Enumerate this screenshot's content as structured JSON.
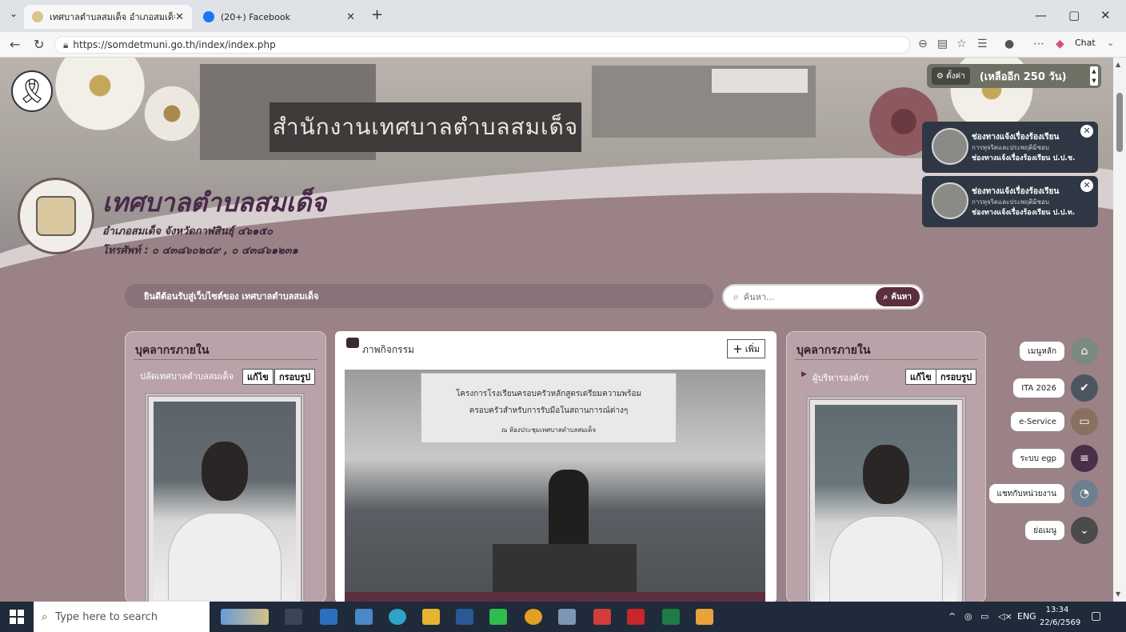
{
  "browser": {
    "tabs": [
      {
        "label": "เทศบาลตำบลสมเด็จ อำเภอสมเด็จ จังหวัด",
        "active": true
      },
      {
        "label": "(20+) Facebook",
        "active": false
      }
    ],
    "new_tab": "+",
    "url": "https://somdetmuni.go.th/index/index.php",
    "chat_label": "Chat"
  },
  "site": {
    "mourning_icon": "ribbon-icon",
    "building_sign": "สำนักงานเทศบาลตำบลสมเด็จ",
    "title": "เทศบาลตำบลสมเด็จ",
    "subtitle": "อำเภอสมเด็จ จังหวัดกาฬสินธุ์ ๔๖๑๕๐",
    "phone": "โทรศัพท์ : ๐ ๔๓๘๖๐๒๔๙ , ๐ ๔๓๘๖๑๒๓๑"
  },
  "countdown": {
    "settings_label": "⚙ ตั้งค่า",
    "text": "(เหลืออีก 250 วัน)"
  },
  "notifications": [
    {
      "title": "ช่องทางแจ้งเรื่องร้องเรียน",
      "sub": "การทุจริตและประพฤติมิชอบ",
      "org": "ช่องทางแจ้งเรื่องร้องเรียน ป.ป.ช."
    },
    {
      "title": "ช่องทางแจ้งเรื่องร้องเรียน",
      "sub": "การทุจริตและประพฤติมิชอบ",
      "org": "ช่องทางแจ้งเรื่องร้องเรียน ป.ป.ท."
    }
  ],
  "welcome_text": "ยินดีต้อนรับสู่เว็บไซต์ของ เทศบาลตำบลสมเด็จ",
  "search": {
    "placeholder": "ค้นหา...",
    "button": "ค้นหา"
  },
  "left_panel": {
    "title": "บุคลากรภายใน",
    "role": "ปลัดเทศบาลตำบลสมเด็จ",
    "edit": "แก้ไข",
    "frame": "กรอบรูป"
  },
  "activity": {
    "title": "ภาพกิจกรรม",
    "add": "เพิ่ม",
    "banner_line1": "โครงการโรงเรียนครอบครัวหลักสูตรเตรียมความพร้อม",
    "banner_line2": "ครอบครัวสำหรับการรับมือในสถานการณ์ต่างๆ",
    "banner_line3": "ณ ห้องประชุมเทศบาลตำบลสมเด็จ"
  },
  "right_panel": {
    "title": "บุคลากรภายใน",
    "role": "ผู้บริหารองค์กร",
    "edit": "แก้ไข",
    "frame": "กรอบรูป"
  },
  "fab_menu": [
    {
      "label": "เมนูหลัก",
      "icon": "home-icon",
      "color": "#7a8a7e"
    },
    {
      "label": "ITA 2026",
      "icon": "check-badge-icon",
      "color": "#4c5560"
    },
    {
      "label": "e-Service",
      "icon": "monitor-icon",
      "color": "#8a7060"
    },
    {
      "label": "ระบบ egp",
      "icon": "list-icon",
      "color": "#4a2f48"
    },
    {
      "label": "แชทกับหน่วยงาน",
      "icon": "messenger-icon",
      "color": "#6e7f90"
    },
    {
      "label": "ย่อเมนู",
      "icon": "chevron-down-icon",
      "color": "#4b4b4b"
    }
  ],
  "taskbar": {
    "search_placeholder": "Type here to search",
    "lang": "ENG",
    "time": "13:34",
    "date": "22/6/2569"
  }
}
